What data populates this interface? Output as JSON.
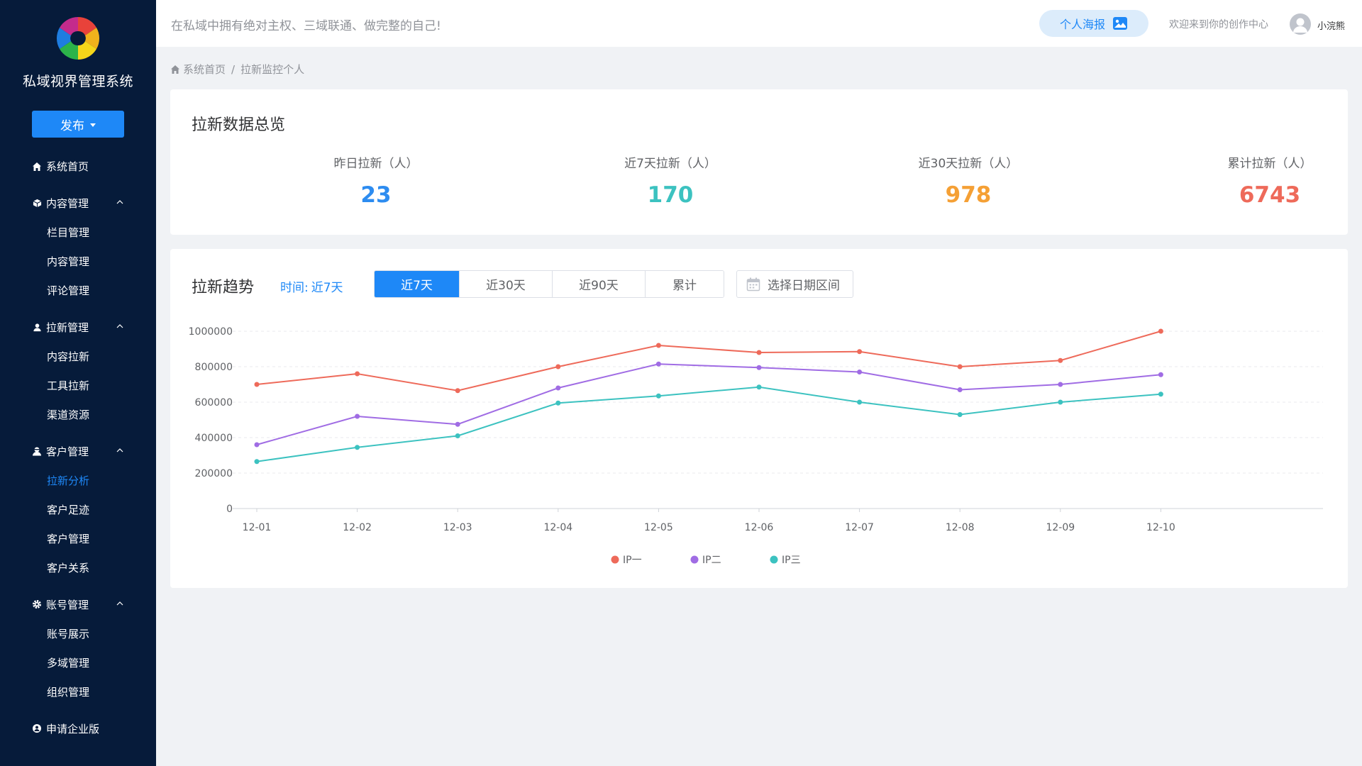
{
  "sidebar": {
    "app_title": "私域视界管理系统",
    "publish_label": "发布",
    "home_label": "系统首页",
    "groups": [
      {
        "label": "内容管理",
        "icon": "cube-icon",
        "items": [
          "栏目管理",
          "内容管理",
          "评论管理"
        ]
      },
      {
        "label": "拉新管理",
        "icon": "user-icon",
        "items": [
          "内容拉新",
          "工具拉新",
          "渠道资源"
        ]
      },
      {
        "label": "客户管理",
        "icon": "customer-icon",
        "items": [
          "拉新分析",
          "客户足迹",
          "客户管理",
          "客户关系"
        ]
      },
      {
        "label": "账号管理",
        "icon": "gear-icon",
        "items": [
          "账号展示",
          "多域管理",
          "组织管理"
        ]
      }
    ],
    "active_item": "拉新分析",
    "enterprise_label": "申请企业版"
  },
  "header": {
    "slogan": "在私域中拥有绝对主权、三域联通、做完整的自己!",
    "poster_label": "个人海报",
    "welcome": "欢迎来到你的创作中心",
    "username": "小浣熊"
  },
  "breadcrumb": {
    "home": "系统首页",
    "separator": "/",
    "current": "拉新监控个人"
  },
  "overview": {
    "title": "拉新数据总览",
    "stats": [
      {
        "label": "昨日拉新（人）",
        "value": "23",
        "color": "#2d8cf0"
      },
      {
        "label": "近7天拉新（人）",
        "value": "170",
        "color": "#3cc2c0"
      },
      {
        "label": "近30天拉新（人）",
        "value": "978",
        "color": "#f5a035"
      },
      {
        "label": "累计拉新（人）",
        "value": "6743",
        "color": "#ee6a5a"
      }
    ]
  },
  "trend": {
    "title": "拉新趋势",
    "time_prefix": "时间:",
    "time_value": "近7天",
    "ranges": [
      "近7天",
      "近30天",
      "近90天",
      "累计"
    ],
    "active_range": "近7天",
    "date_picker_label": "选择日期区间"
  },
  "chart_data": {
    "type": "line",
    "x": [
      "12-01",
      "12-02",
      "12-03",
      "12-04",
      "12-05",
      "12-06",
      "12-07",
      "12-08",
      "12-09",
      "12-10"
    ],
    "ylim": [
      0,
      1000000
    ],
    "yticks": [
      "0",
      "200000",
      "400000",
      "600000",
      "800000",
      "1000000"
    ],
    "grid": true,
    "legend_position": "bottom-center",
    "series": [
      {
        "name": "IP一",
        "color": "#ee6a5a",
        "values": [
          700000,
          760000,
          665000,
          800000,
          920000,
          880000,
          885000,
          800000,
          835000,
          1000000
        ]
      },
      {
        "name": "IP二",
        "color": "#a06ce4",
        "values": [
          360000,
          520000,
          475000,
          680000,
          815000,
          795000,
          770000,
          670000,
          700000,
          755000
        ]
      },
      {
        "name": "IP三",
        "color": "#3cc2c0",
        "values": [
          265000,
          345000,
          410000,
          595000,
          635000,
          685000,
          600000,
          530000,
          600000,
          645000
        ]
      }
    ]
  }
}
